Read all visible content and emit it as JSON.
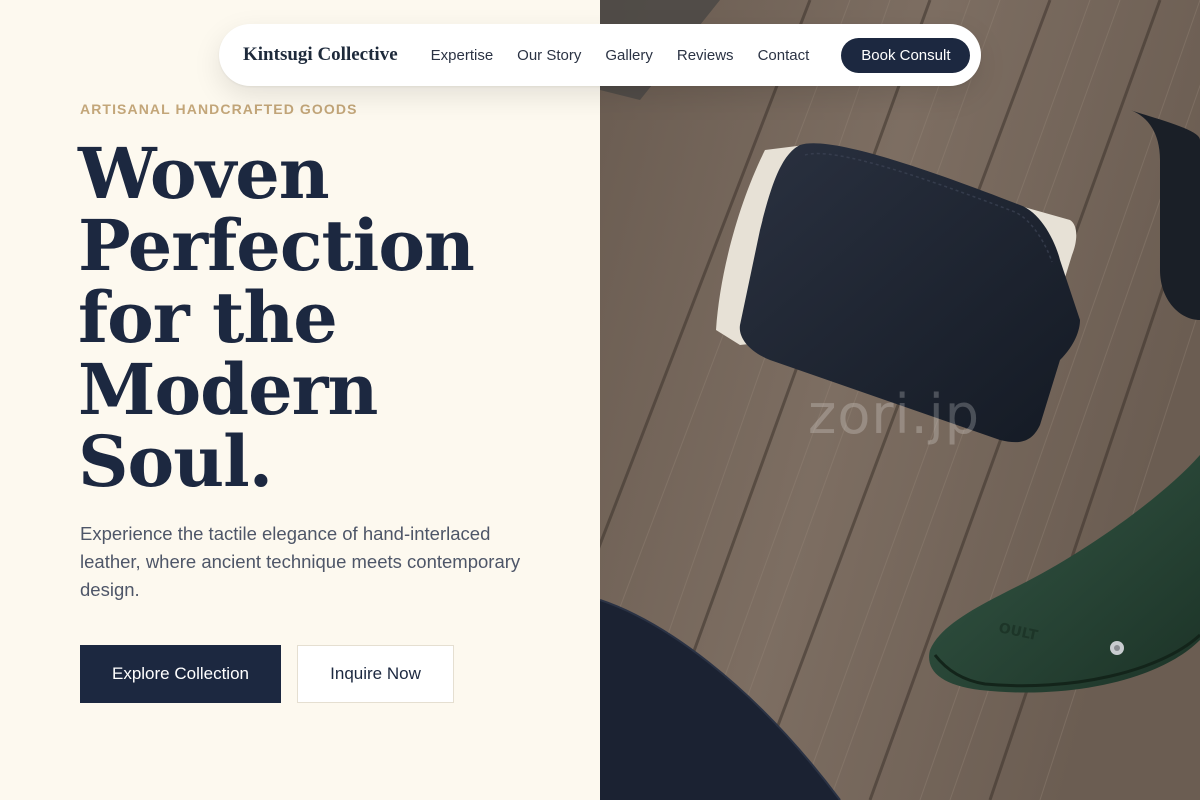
{
  "nav": {
    "brand": "Kintsugi Collective",
    "links": [
      "Expertise",
      "Our Story",
      "Gallery",
      "Reviews",
      "Contact"
    ],
    "cta": "Book Consult"
  },
  "hero": {
    "eyebrow": "ARTISANAL HANDCRAFTED GOODS",
    "headline": "Woven Perfection for the Modern Soul.",
    "subtext": "Experience the tactile elegance of hand-interlaced leather, where ancient technique meets contemporary design.",
    "primary_cta": "Explore Collection",
    "secondary_cta": "Inquire Now"
  },
  "image": {
    "watermark": "zori.jp",
    "stamp": "OULT"
  },
  "colors": {
    "background": "#fdf9ef",
    "navy": "#1c2840",
    "gold": "#c3a679",
    "body_text": "#4e5668"
  }
}
